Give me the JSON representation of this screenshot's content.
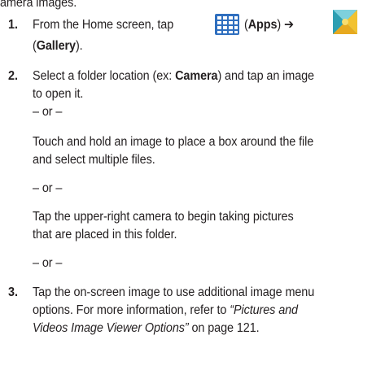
{
  "intro_fragment": "amera images.",
  "steps": [
    {
      "number": "1.",
      "text_a": "From the Home screen, tap",
      "apps_label": "Apps",
      "arrow": "➔",
      "gallery_label": "Gallery",
      "icons": [
        "apps-grid-icon",
        "gallery-icon"
      ]
    },
    {
      "number": "2.",
      "line1_a": "Select a folder location (ex: ",
      "line1_bold": "Camera",
      "line1_b": ") and tap an image",
      "line2": "to open it.",
      "or": "– or –",
      "alt1_line1": "Touch and hold an image to place a box around the file",
      "alt1_line2": "and select multiple files.",
      "alt2_line1": "Tap the upper-right camera to begin taking pictures",
      "alt2_line2": "that are placed in this folder."
    },
    {
      "number": "3.",
      "line1": "Tap the on-screen image to use additional image menu",
      "line2_a": "options. For more information, refer to ",
      "line2_italic": "“Pictures and",
      "line3_italic": "Videos Image Viewer Options”",
      "line3_b": " on page 121."
    }
  ],
  "colors": {
    "text": "#231f20",
    "apps_icon_blue": "#2f6fbf",
    "gallery_yellow": "#f2c230",
    "gallery_teal": "#3fb7c9"
  }
}
